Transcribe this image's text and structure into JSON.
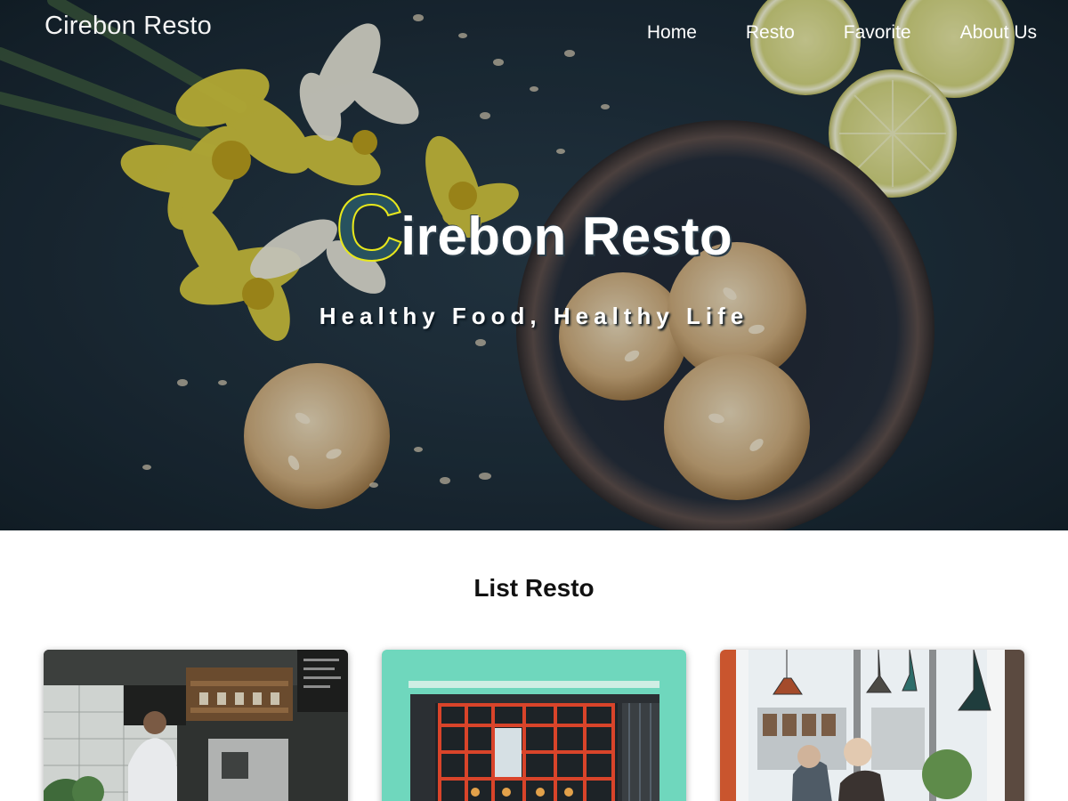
{
  "header": {
    "brand": "Cirebon Resto",
    "nav": [
      {
        "label": "Home"
      },
      {
        "label": "Resto"
      },
      {
        "label": "Favorite"
      },
      {
        "label": "About Us"
      }
    ]
  },
  "hero": {
    "title_initial": "C",
    "title_rest": "irebon Resto",
    "tagline": "Healthy Food, Healthy Life"
  },
  "list": {
    "title": "List Resto",
    "cards": [
      {
        "image": "coffee-bar-photo"
      },
      {
        "image": "green-storefront-photo"
      },
      {
        "image": "cafe-interior-photo"
      }
    ]
  },
  "colors": {
    "title_initial_fill": "#27525f",
    "title_initial_stroke": "#e8e81c",
    "hero_bg": "#1a2a36"
  }
}
